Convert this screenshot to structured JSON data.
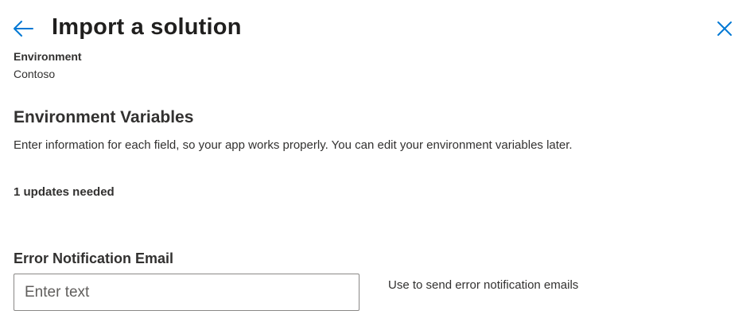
{
  "header": {
    "title": "Import a solution",
    "back_icon": "arrow-left-icon",
    "close_icon": "close-icon",
    "accent_color": "#0078d4"
  },
  "environment": {
    "label": "Environment",
    "value": "Contoso"
  },
  "env_variables": {
    "title": "Environment Variables",
    "description": "Enter information for each field, so your app works properly. You can edit your environment variables later.",
    "updates_needed": "1 updates needed",
    "field": {
      "label": "Error Notification Email",
      "value": "",
      "placeholder": "Enter text",
      "help": "Use to send error notification emails"
    }
  }
}
